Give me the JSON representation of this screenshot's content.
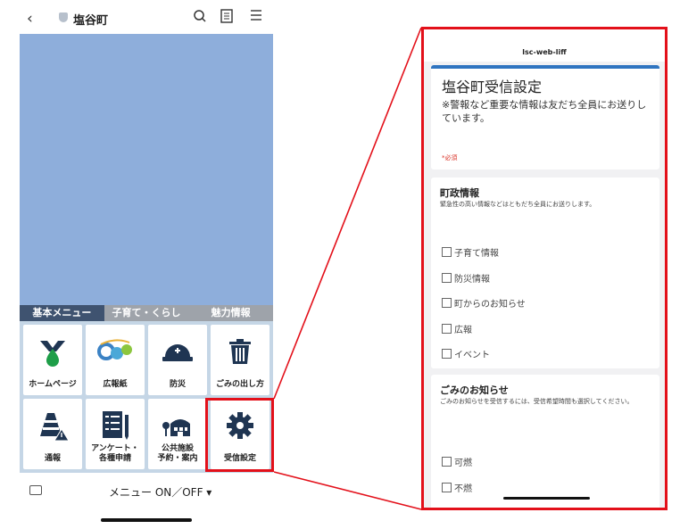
{
  "phone": {
    "header": {
      "title": "塩谷町"
    },
    "tabs": [
      "基本メニュー",
      "子育て・くらし",
      "魅力情報"
    ],
    "tiles": [
      {
        "label": "ホームページ",
        "icon": "town-emblem-icon"
      },
      {
        "label": "広報紙",
        "icon": "newsletter-logo-icon"
      },
      {
        "label": "防災",
        "icon": "helmet-icon"
      },
      {
        "label": "ごみの出し方",
        "icon": "trash-icon"
      },
      {
        "label": "通報",
        "icon": "warning-cone-icon"
      },
      {
        "label": "アンケート・\n各種申請",
        "icon": "survey-form-icon"
      },
      {
        "label": "公共施設\n予約・案内",
        "icon": "facility-icon"
      },
      {
        "label": "受信設定",
        "icon": "gear-icon"
      }
    ],
    "bottom": {
      "menu_label": "メニュー ON／OFF ▾"
    }
  },
  "form": {
    "app_name": "lsc-web-liff",
    "title": "塩谷町受信設定",
    "description": "※警報など重要な情報は友だち全員にお送りしています。",
    "required_note": "*必須",
    "sections": [
      {
        "title": "町政情報",
        "description": "緊急性の高い情報などはともだち全員にお送りします。",
        "options": [
          "子育て情報",
          "防災情報",
          "町からのお知らせ",
          "広報",
          "イベント"
        ]
      },
      {
        "title": "ごみのお知らせ",
        "description": "ごみのお知らせを受信するには、受信希望時間も選択してください。",
        "options": [
          "可燃",
          "不燃"
        ]
      }
    ]
  },
  "colors": {
    "accent": "#2f74c0",
    "highlight": "#e3101a",
    "banner": "#8eaedb",
    "active_tab": "#3f5370",
    "icon_navy": "#1f3552"
  }
}
